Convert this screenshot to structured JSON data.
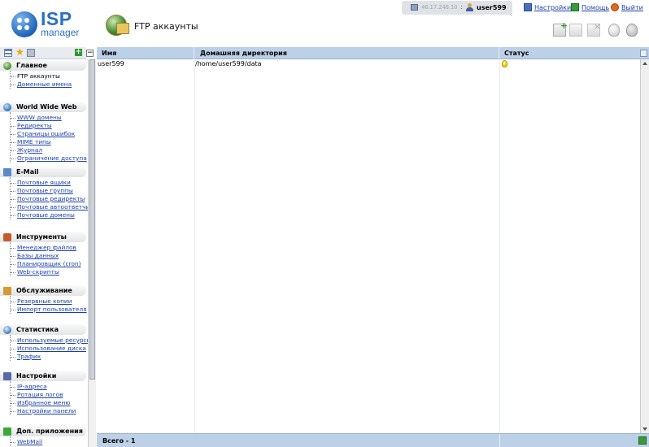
{
  "header": {
    "logo_isp": "ISP",
    "logo_manager": "manager",
    "page_title": "FTP аккаунты",
    "ip_address": "46.17.248.10",
    "username": "user599",
    "links": {
      "settings": "Настройки",
      "help": "Помощь",
      "logout": "Выйти"
    }
  },
  "toolbar": {
    "buttons": [
      "new-icon",
      "edit-icon",
      "delete-icon",
      "enable-icon",
      "disable-icon"
    ]
  },
  "sidebar": {
    "sections": [
      {
        "title": "Главное",
        "icon": "home-icon",
        "items": [
          "FTP аккаунты",
          "Доменные имена"
        ],
        "current": 0
      },
      {
        "title": "World Wide Web",
        "icon": "globe-icon",
        "items": [
          "WWW домены",
          "Редиректы",
          "Страницы ошибок",
          "MIME типы",
          "Журнал",
          "Ограничение доступа"
        ]
      },
      {
        "title": "E-Mail",
        "icon": "mail-icon",
        "items": [
          "Почтовые ящики",
          "Почтовые группы",
          "Почтовые редиректы",
          "Почтовые автоответчики",
          "Почтовые домены"
        ]
      },
      {
        "title": "Инструменты",
        "icon": "tools-icon",
        "items": [
          "Менеджер файлов",
          "Базы данных",
          "Планировщик (cron)",
          "Web-скрипты"
        ]
      },
      {
        "title": "Обслуживание",
        "icon": "maintenance-icon",
        "items": [
          "Резервные копии",
          "Импорт пользователя"
        ]
      },
      {
        "title": "Статистика",
        "icon": "statistics-icon",
        "items": [
          "Используемые ресурсы",
          "Использование диска",
          "Трафик"
        ]
      },
      {
        "title": "Настройки",
        "icon": "settings-icon",
        "items": [
          "IP-адреса",
          "Ротация логов",
          "Избранное меню",
          "Настройки панели"
        ]
      },
      {
        "title": "Доп. приложения",
        "icon": "apps-icon",
        "items": [
          "WebMail"
        ]
      }
    ]
  },
  "table": {
    "columns": [
      "Имя",
      "Домашняя директория",
      "Статус"
    ],
    "rows": [
      {
        "name": "user599",
        "dir": "/home/user599/data",
        "status_icon": "bulb-on-icon"
      }
    ],
    "footer": "Всего - 1"
  }
}
